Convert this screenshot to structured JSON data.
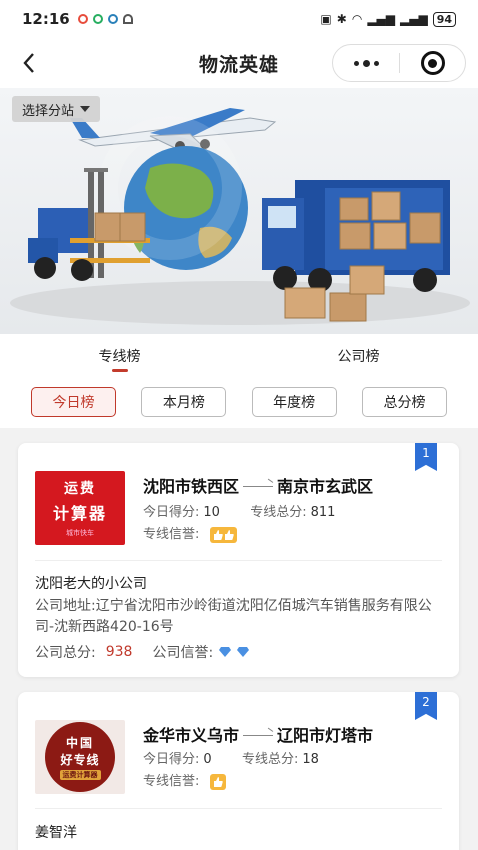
{
  "status_bar": {
    "time": "12:16",
    "battery": "94"
  },
  "nav": {
    "title": "物流英雄"
  },
  "banner": {
    "station_label": "选择分站"
  },
  "tabs": [
    {
      "label": "专线榜",
      "active": true
    },
    {
      "label": "公司榜",
      "active": false
    }
  ],
  "filters": [
    {
      "label": "今日榜",
      "active": true
    },
    {
      "label": "本月榜"
    },
    {
      "label": "年度榜"
    },
    {
      "label": "总分榜"
    }
  ],
  "labels": {
    "today_score": "今日得分:",
    "line_total": "专线总分:",
    "line_credit": "专线信誉:",
    "address": "公司地址:",
    "company_total": "公司总分:",
    "company_credit": "公司信誉:"
  },
  "cards": [
    {
      "rank": "1",
      "logo": {
        "line1": "运费",
        "line2": "计算器",
        "line3": "城市快车"
      },
      "from": "沈阳市铁西区",
      "to": "南京市玄武区",
      "today_score": "10",
      "line_total": "811",
      "line_credit_thumbs": 2,
      "company": "沈阳老大的小公司",
      "address": "辽宁省沈阳市沙岭街道沈阳亿佰城汽车销售服务有限公司-沈新西路420-16号",
      "company_total": "938",
      "company_credit_diamonds": 2
    },
    {
      "rank": "2",
      "logo": {
        "line1": "中国",
        "line2": "好专线",
        "line3": "运费计算器"
      },
      "from": "金华市义乌市",
      "to": "辽阳市灯塔市",
      "today_score": "0",
      "line_total": "18",
      "line_credit_thumbs": 1,
      "company": "姜智洋"
    }
  ],
  "colors": {
    "accent": "#c0392b",
    "rank_flag": "#2d6fd6",
    "badge": "#f6b73c",
    "diamond": "#4a90e2"
  }
}
